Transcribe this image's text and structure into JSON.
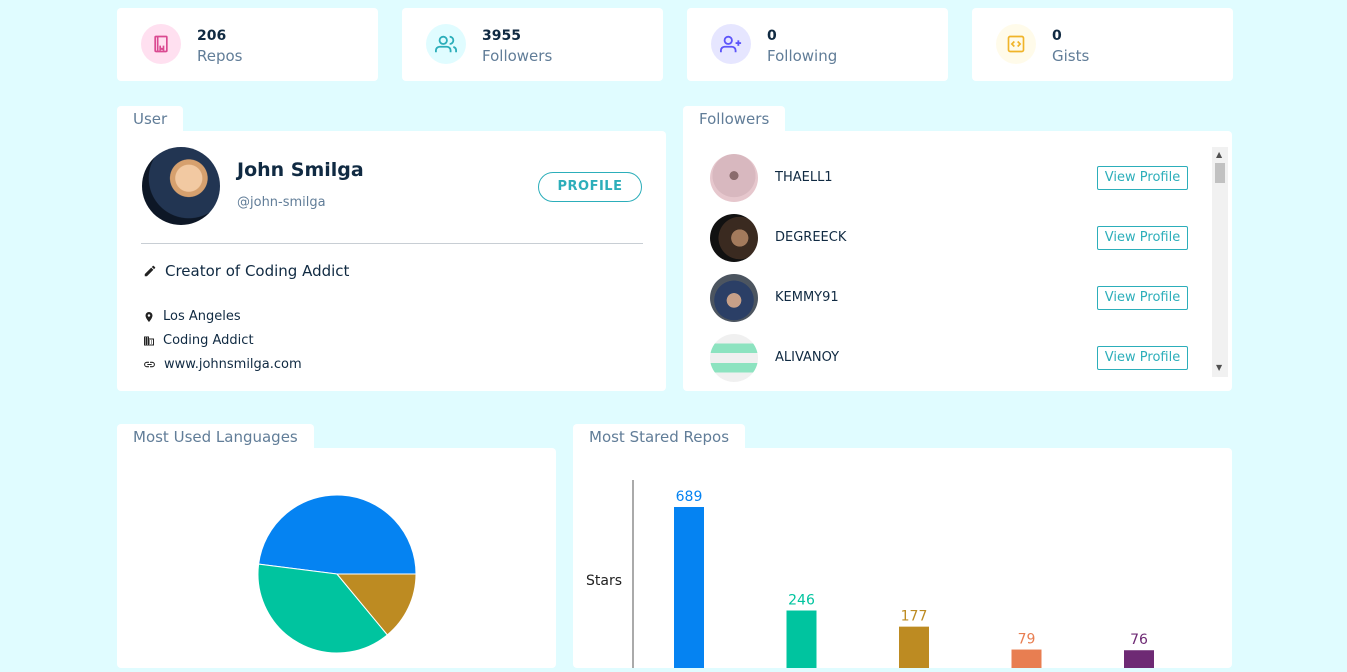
{
  "stats": [
    {
      "value": "206",
      "label": "Repos",
      "icon": "book-icon",
      "bg": "#ffe0f0",
      "color": "#da4a91"
    },
    {
      "value": "3955",
      "label": "Followers",
      "icon": "users-icon",
      "bg": "#e0fcff",
      "color": "#2caeba"
    },
    {
      "value": "0",
      "label": "Following",
      "icon": "user-plus-icon",
      "bg": "#e6e6ff",
      "color": "#5d55fa"
    },
    {
      "value": "0",
      "label": "Gists",
      "icon": "code-icon",
      "bg": "#fffbea",
      "color": "#f0b429"
    }
  ],
  "user": {
    "tab": "User",
    "name": "John Smilga",
    "handle": "@john-smilga",
    "profile_button": "PROFILE",
    "bio": "Creator of Coding Addict",
    "location": "Los Angeles",
    "company": "Coding Addict",
    "blog": "www.johnsmilga.com"
  },
  "followers": {
    "tab": "Followers",
    "button_label": "View Profile",
    "items": [
      {
        "login": "THAELL1"
      },
      {
        "login": "DEGREECK"
      },
      {
        "login": "KEMMY91"
      },
      {
        "login": "ALIVANOY"
      }
    ]
  },
  "languages": {
    "tab": "Most Used Languages"
  },
  "repos": {
    "tab": "Most Stared Repos",
    "ylabel": "Stars"
  },
  "chart_data": [
    {
      "type": "pie",
      "title": "",
      "values": [
        48,
        38,
        14
      ],
      "colors": [
        "#0583f2",
        "#00c49f",
        "#bd8b22"
      ]
    },
    {
      "type": "bar",
      "title": "",
      "ylabel": "Stars",
      "values": [
        689,
        246,
        177,
        79,
        76
      ],
      "colors": [
        "#0583f2",
        "#00c49f",
        "#bd8b22",
        "#e87e51",
        "#6e2a74"
      ]
    }
  ],
  "colors": {
    "background": "#e0fcff",
    "accent": "#2caeba",
    "text": "#102a42",
    "muted": "#617d98"
  }
}
